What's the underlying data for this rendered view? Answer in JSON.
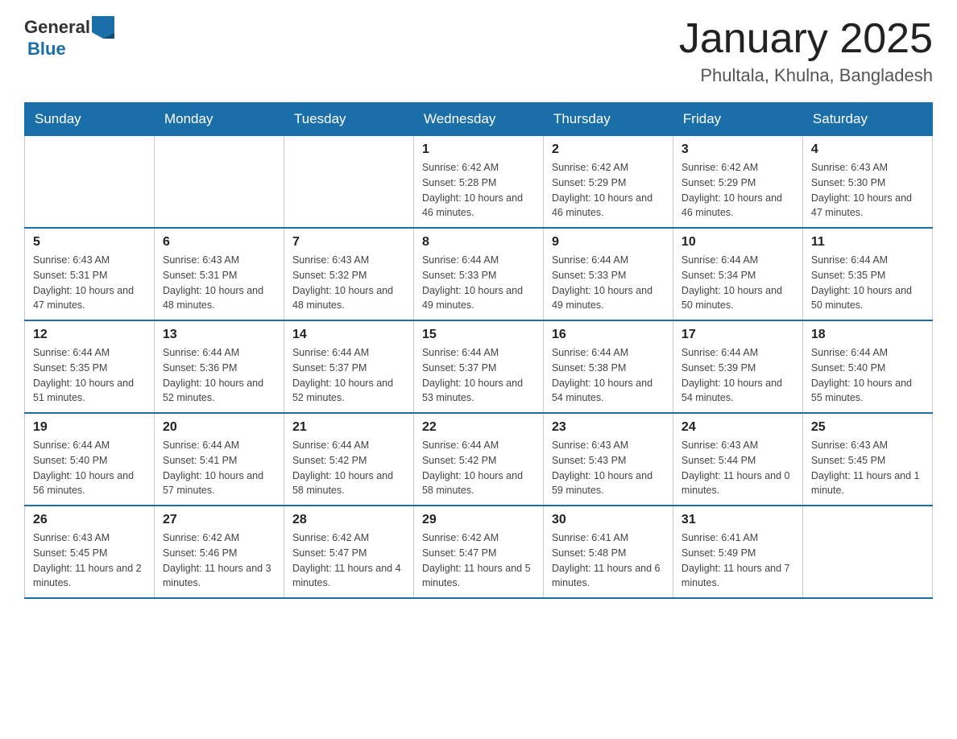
{
  "logo": {
    "text_general": "General",
    "text_blue": "Blue"
  },
  "title": "January 2025",
  "subtitle": "Phultala, Khulna, Bangladesh",
  "days_of_week": [
    "Sunday",
    "Monday",
    "Tuesday",
    "Wednesday",
    "Thursday",
    "Friday",
    "Saturday"
  ],
  "weeks": [
    [
      {
        "day": "",
        "info": ""
      },
      {
        "day": "",
        "info": ""
      },
      {
        "day": "",
        "info": ""
      },
      {
        "day": "1",
        "info": "Sunrise: 6:42 AM\nSunset: 5:28 PM\nDaylight: 10 hours and 46 minutes."
      },
      {
        "day": "2",
        "info": "Sunrise: 6:42 AM\nSunset: 5:29 PM\nDaylight: 10 hours and 46 minutes."
      },
      {
        "day": "3",
        "info": "Sunrise: 6:42 AM\nSunset: 5:29 PM\nDaylight: 10 hours and 46 minutes."
      },
      {
        "day": "4",
        "info": "Sunrise: 6:43 AM\nSunset: 5:30 PM\nDaylight: 10 hours and 47 minutes."
      }
    ],
    [
      {
        "day": "5",
        "info": "Sunrise: 6:43 AM\nSunset: 5:31 PM\nDaylight: 10 hours and 47 minutes."
      },
      {
        "day": "6",
        "info": "Sunrise: 6:43 AM\nSunset: 5:31 PM\nDaylight: 10 hours and 48 minutes."
      },
      {
        "day": "7",
        "info": "Sunrise: 6:43 AM\nSunset: 5:32 PM\nDaylight: 10 hours and 48 minutes."
      },
      {
        "day": "8",
        "info": "Sunrise: 6:44 AM\nSunset: 5:33 PM\nDaylight: 10 hours and 49 minutes."
      },
      {
        "day": "9",
        "info": "Sunrise: 6:44 AM\nSunset: 5:33 PM\nDaylight: 10 hours and 49 minutes."
      },
      {
        "day": "10",
        "info": "Sunrise: 6:44 AM\nSunset: 5:34 PM\nDaylight: 10 hours and 50 minutes."
      },
      {
        "day": "11",
        "info": "Sunrise: 6:44 AM\nSunset: 5:35 PM\nDaylight: 10 hours and 50 minutes."
      }
    ],
    [
      {
        "day": "12",
        "info": "Sunrise: 6:44 AM\nSunset: 5:35 PM\nDaylight: 10 hours and 51 minutes."
      },
      {
        "day": "13",
        "info": "Sunrise: 6:44 AM\nSunset: 5:36 PM\nDaylight: 10 hours and 52 minutes."
      },
      {
        "day": "14",
        "info": "Sunrise: 6:44 AM\nSunset: 5:37 PM\nDaylight: 10 hours and 52 minutes."
      },
      {
        "day": "15",
        "info": "Sunrise: 6:44 AM\nSunset: 5:37 PM\nDaylight: 10 hours and 53 minutes."
      },
      {
        "day": "16",
        "info": "Sunrise: 6:44 AM\nSunset: 5:38 PM\nDaylight: 10 hours and 54 minutes."
      },
      {
        "day": "17",
        "info": "Sunrise: 6:44 AM\nSunset: 5:39 PM\nDaylight: 10 hours and 54 minutes."
      },
      {
        "day": "18",
        "info": "Sunrise: 6:44 AM\nSunset: 5:40 PM\nDaylight: 10 hours and 55 minutes."
      }
    ],
    [
      {
        "day": "19",
        "info": "Sunrise: 6:44 AM\nSunset: 5:40 PM\nDaylight: 10 hours and 56 minutes."
      },
      {
        "day": "20",
        "info": "Sunrise: 6:44 AM\nSunset: 5:41 PM\nDaylight: 10 hours and 57 minutes."
      },
      {
        "day": "21",
        "info": "Sunrise: 6:44 AM\nSunset: 5:42 PM\nDaylight: 10 hours and 58 minutes."
      },
      {
        "day": "22",
        "info": "Sunrise: 6:44 AM\nSunset: 5:42 PM\nDaylight: 10 hours and 58 minutes."
      },
      {
        "day": "23",
        "info": "Sunrise: 6:43 AM\nSunset: 5:43 PM\nDaylight: 10 hours and 59 minutes."
      },
      {
        "day": "24",
        "info": "Sunrise: 6:43 AM\nSunset: 5:44 PM\nDaylight: 11 hours and 0 minutes."
      },
      {
        "day": "25",
        "info": "Sunrise: 6:43 AM\nSunset: 5:45 PM\nDaylight: 11 hours and 1 minute."
      }
    ],
    [
      {
        "day": "26",
        "info": "Sunrise: 6:43 AM\nSunset: 5:45 PM\nDaylight: 11 hours and 2 minutes."
      },
      {
        "day": "27",
        "info": "Sunrise: 6:42 AM\nSunset: 5:46 PM\nDaylight: 11 hours and 3 minutes."
      },
      {
        "day": "28",
        "info": "Sunrise: 6:42 AM\nSunset: 5:47 PM\nDaylight: 11 hours and 4 minutes."
      },
      {
        "day": "29",
        "info": "Sunrise: 6:42 AM\nSunset: 5:47 PM\nDaylight: 11 hours and 5 minutes."
      },
      {
        "day": "30",
        "info": "Sunrise: 6:41 AM\nSunset: 5:48 PM\nDaylight: 11 hours and 6 minutes."
      },
      {
        "day": "31",
        "info": "Sunrise: 6:41 AM\nSunset: 5:49 PM\nDaylight: 11 hours and 7 minutes."
      },
      {
        "day": "",
        "info": ""
      }
    ]
  ]
}
